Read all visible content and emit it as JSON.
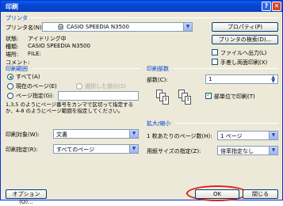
{
  "title": "印刷",
  "printer": {
    "group": "プリンタ",
    "name_label": "プリンタ名(N):",
    "name_value": "CASIO SPEEDIA N3500",
    "properties_button": "プロパティ(P)",
    "find_button": "プリンタの検索(D)...",
    "status_label": "状態:",
    "status_value": "アイドリング中",
    "type_label": "種類:",
    "type_value": "CASIO SPEEDIA N3500",
    "where_label": "場所:",
    "where_value": "FILE:",
    "comment_label": "コメント:",
    "file_output": "ファイルへ出力(L)",
    "manual_duplex": "手差し両面印刷(X)"
  },
  "range": {
    "group": "印刷範囲",
    "all": "すべて(A)",
    "current": "現在のページ(E)",
    "selection": "選択した部分(S)",
    "pages": "ページ指定(G):",
    "help_text": "1,3,5 のようにページ番号をカンマで区切って指定するか、4-8 のようにページ範囲を指定してください。"
  },
  "copies": {
    "group": "印刷部数",
    "count_label": "部数(C):",
    "count_value": "1",
    "collate": "部単位で印刷(T)"
  },
  "print_target": {
    "label": "印刷対象(W):",
    "value": "文書"
  },
  "print_pages": {
    "label": "印刷指定(R):",
    "value": "すべてのページ"
  },
  "zoom": {
    "group": "拡大/縮小",
    "per_sheet_label": "1 枚あたりのページ数(H):",
    "per_sheet_value": "1 ページ",
    "paper_label": "用紙サイズの指定(Z):",
    "paper_value": "倍率指定なし"
  },
  "buttons": {
    "options": "オプション(O)...",
    "ok": "OK",
    "close": "閉じる"
  },
  "accent": {
    "titlebar": "#0a5ee8",
    "ok_highlight": "#e02020"
  }
}
